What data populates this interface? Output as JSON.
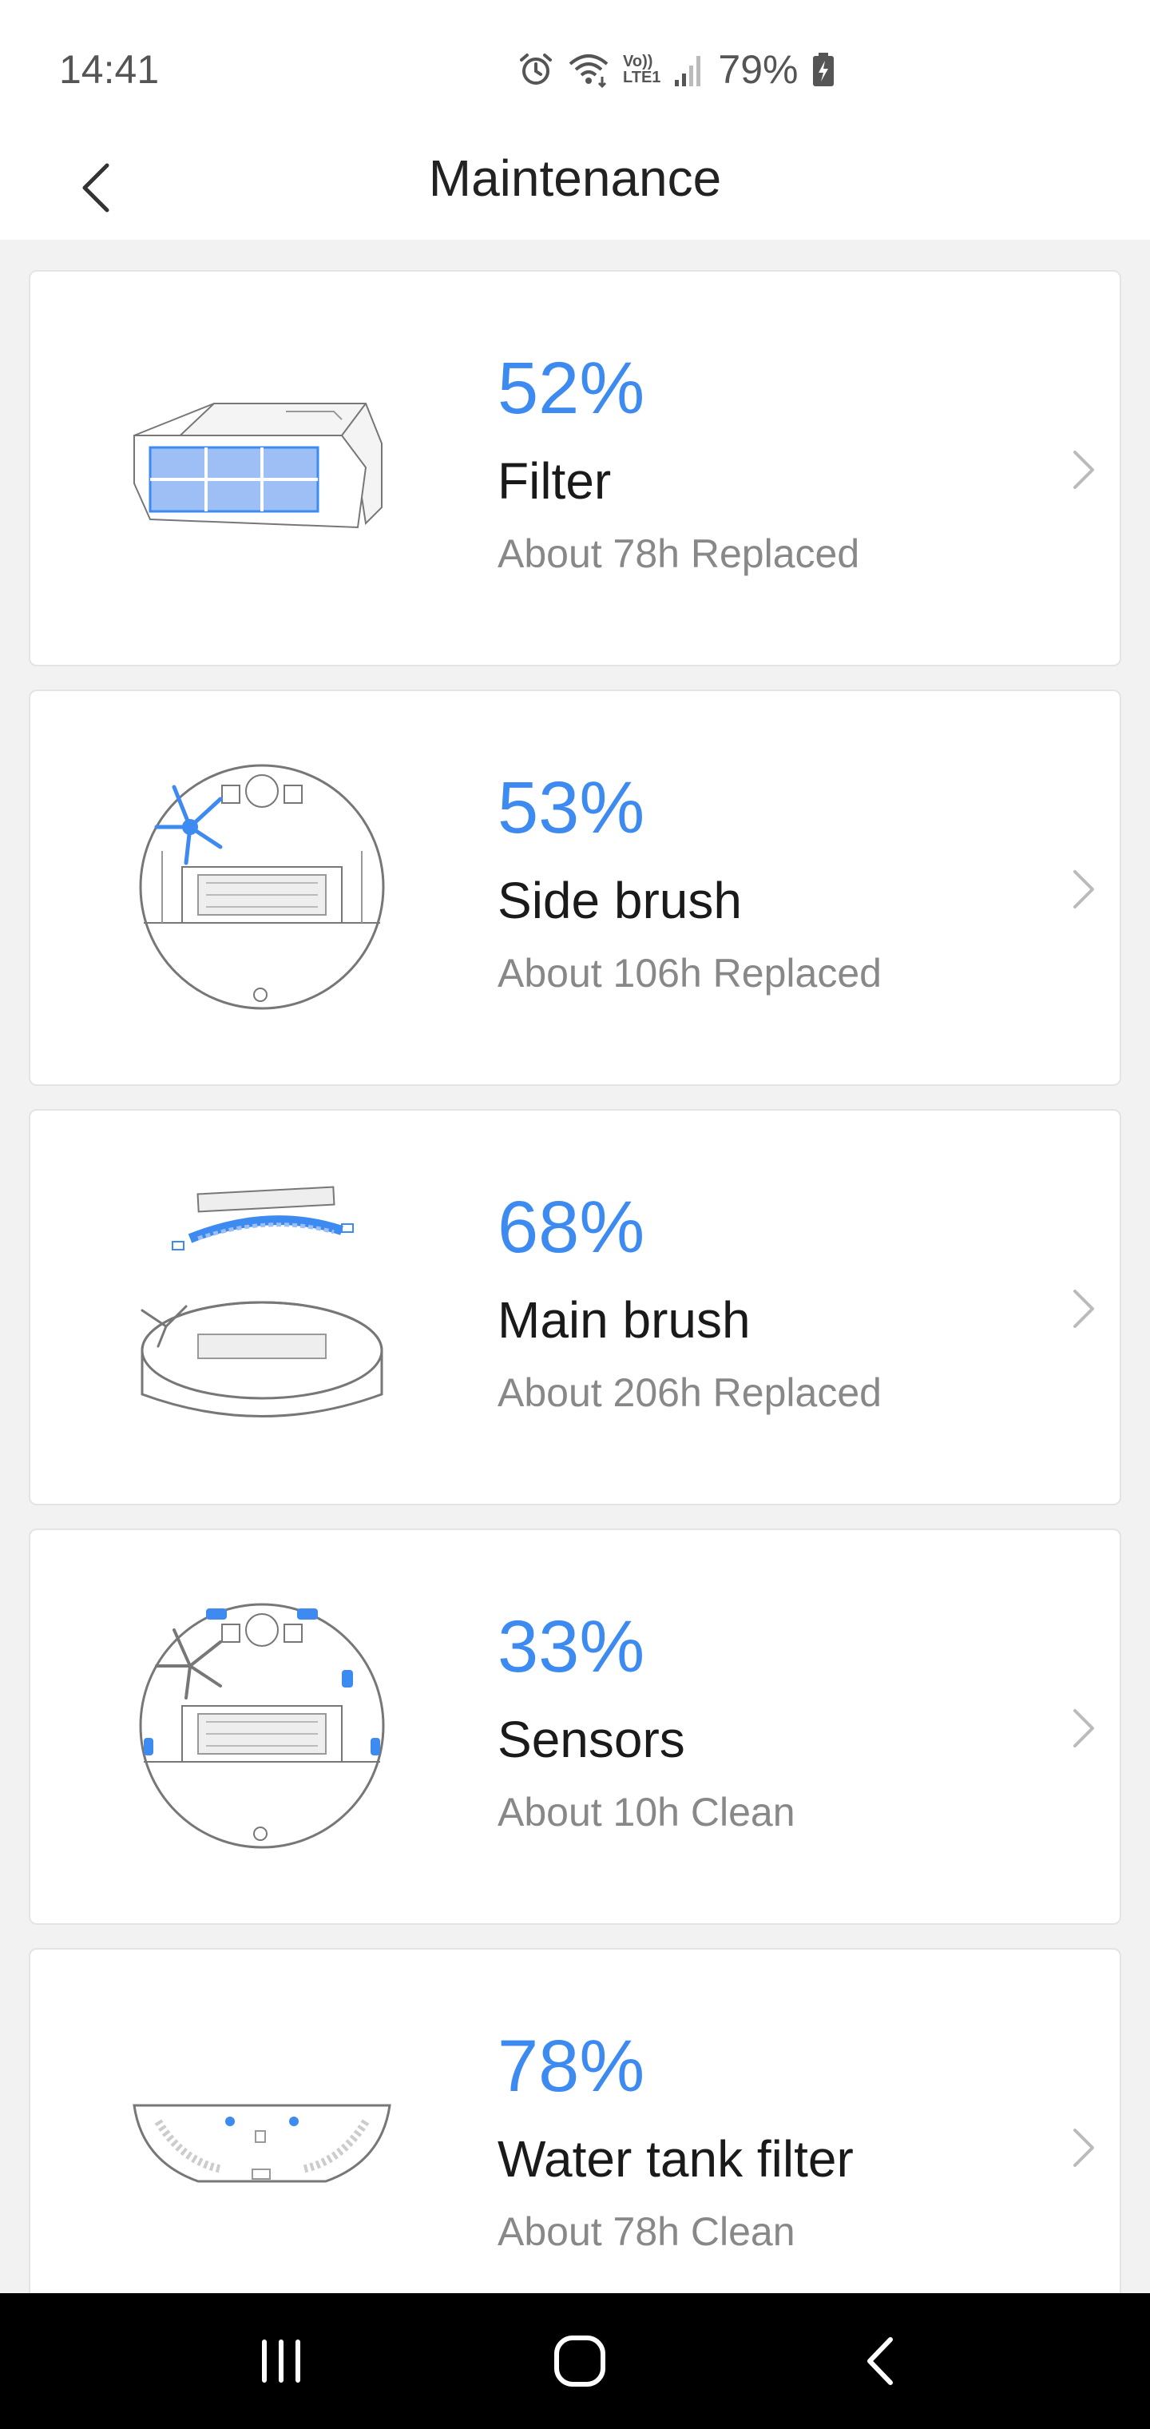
{
  "status_bar": {
    "time": "14:41",
    "volte": "Vo))",
    "lte": "LTE1",
    "battery_percent": "79%",
    "icons": [
      "alarm-icon",
      "wifi-icon",
      "volte-icon",
      "signal-icon",
      "battery-charging-icon"
    ]
  },
  "header": {
    "title": "Maintenance",
    "back_icon": "chevron-left-icon"
  },
  "items": [
    {
      "percent": "52%",
      "name": "Filter",
      "subtitle": "About 78h Replaced",
      "icon": "filter-illustration"
    },
    {
      "percent": "53%",
      "name": "Side brush",
      "subtitle": "About 106h Replaced",
      "icon": "side-brush-illustration"
    },
    {
      "percent": "68%",
      "name": "Main brush",
      "subtitle": "About 206h Replaced",
      "icon": "main-brush-illustration"
    },
    {
      "percent": "33%",
      "name": "Sensors",
      "subtitle": "About 10h Clean",
      "icon": "sensors-illustration"
    },
    {
      "percent": "78%",
      "name": "Water tank filter",
      "subtitle": "About 78h Clean",
      "icon": "water-tank-filter-illustration"
    }
  ],
  "nav_bar": {
    "buttons": [
      "recents-icon",
      "home-icon",
      "back-icon"
    ]
  },
  "colors": {
    "accent": "#3d8af0",
    "text_primary": "#1a1a1a",
    "text_secondary": "#888888",
    "background": "#f2f2f2",
    "card": "#ffffff"
  }
}
